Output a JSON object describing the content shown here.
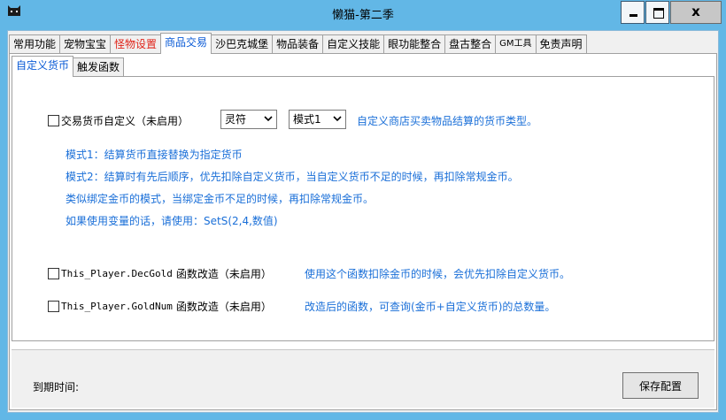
{
  "window": {
    "title": "懒猫-第二季",
    "close_glyph": "x"
  },
  "tabs": [
    {
      "label": "常用功能"
    },
    {
      "label": "宠物宝宝"
    },
    {
      "label": "怪物设置"
    },
    {
      "label": "商品交易"
    },
    {
      "label": "沙巴克城堡"
    },
    {
      "label": "物品装备"
    },
    {
      "label": "自定义技能"
    },
    {
      "label": "眼功能整合"
    },
    {
      "label": "盘古整合"
    },
    {
      "label": "GM工具"
    },
    {
      "label": "免责声明"
    }
  ],
  "active_tab": "商品交易",
  "subtabs": [
    {
      "label": "自定义货币"
    },
    {
      "label": "触发函数"
    }
  ],
  "currency": {
    "checkbox_label": "交易货币自定义（未启用）",
    "currency_select": "灵符",
    "mode_select": "模式1",
    "description": "自定义商店买卖物品结算的货币类型。",
    "notes": [
      "模式1：结算货币直接替换为指定货币",
      "模式2：结算时有先后顺序，优先扣除自定义货币，当自定义货币不足的时候，再扣除常规金币。",
      "类似绑定金币的模式，当绑定金币不足的时候，再扣除常规金币。",
      "如果使用变量的话，请使用：SetS(2,4,数值)"
    ]
  },
  "functions": [
    {
      "code": "This_Player.DecGold",
      "label": "函数改造（未启用）",
      "description": "使用这个函数扣除金币的时候，会优先扣除自定义货币。"
    },
    {
      "code": "This_Player.GoldNum",
      "label": "函数改造（未启用）",
      "description": "改造后的函数，可查询(金币+自定义货币)的总数量。"
    }
  ],
  "footer": {
    "expire_label": "到期时间:",
    "save_label": "保存配置"
  },
  "colors": {
    "titlebar": "#62b7e6",
    "accent_blue": "#1a6fd8",
    "tab_red": "#e0241a"
  }
}
